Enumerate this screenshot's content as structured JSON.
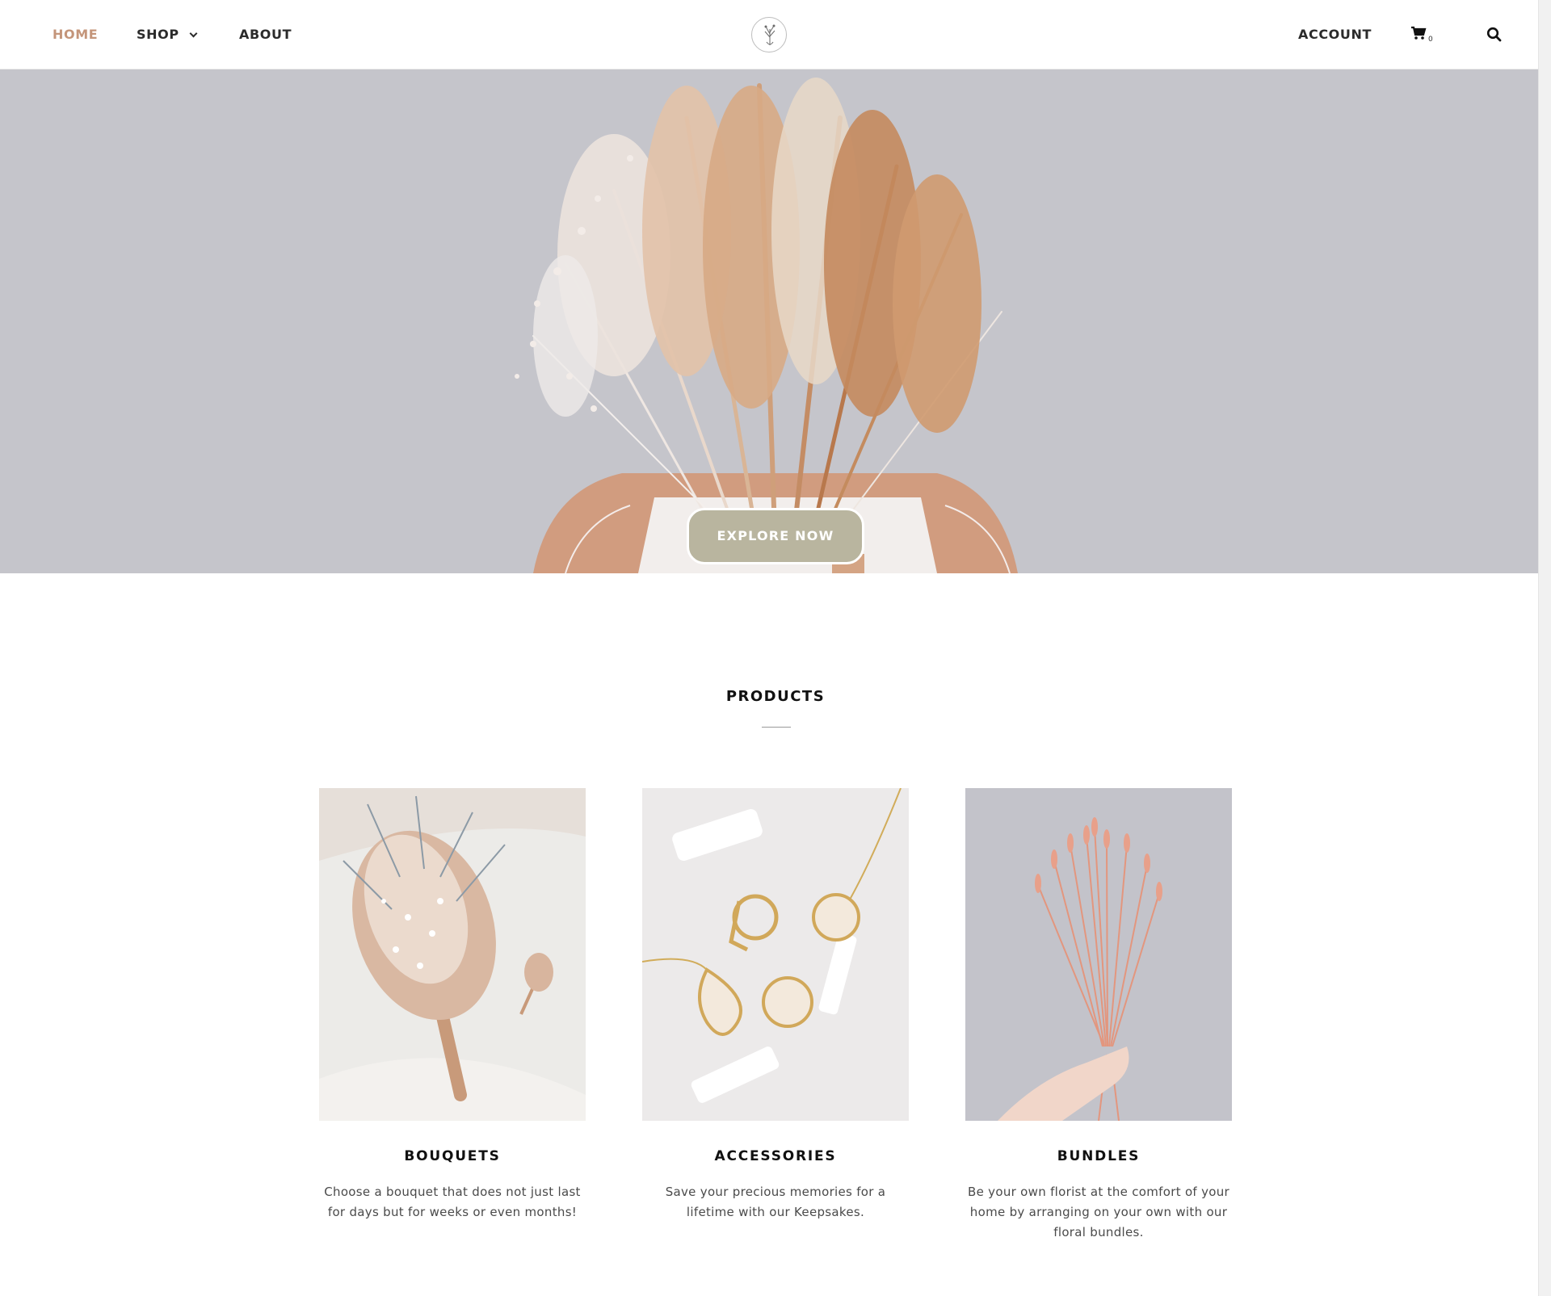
{
  "nav": {
    "home": "HOME",
    "shop": "SHOP",
    "about": "ABOUT",
    "account": "ACCOUNT",
    "cart_count": "0"
  },
  "hero": {
    "cta_label": "EXPLORE NOW"
  },
  "products": {
    "title": "PRODUCTS",
    "items": [
      {
        "title": "BOUQUETS",
        "description": "Choose a bouquet that does not just last for days but for weeks or even months!"
      },
      {
        "title": "ACCESSORIES",
        "description": "Save your precious memories for a lifetime with our Keepsakes."
      },
      {
        "title": "BUNDLES",
        "description": "Be your own florist at the comfort of your home by arranging on your own with our floral bundles."
      }
    ]
  },
  "colors": {
    "accent": "#c4957a",
    "hero_bg": "#c5c5cb",
    "button": "#b9b59f"
  }
}
